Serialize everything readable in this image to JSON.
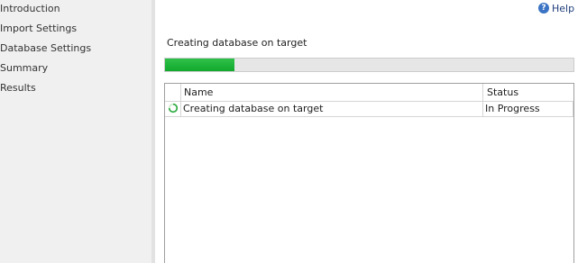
{
  "sidebar": {
    "items": [
      {
        "label": "Introduction"
      },
      {
        "label": "Import Settings"
      },
      {
        "label": "Database Settings"
      },
      {
        "label": "Summary"
      },
      {
        "label": "Results"
      }
    ]
  },
  "help": {
    "label": "Help",
    "icon": "help-icon"
  },
  "stage": {
    "text": "Creating database on target"
  },
  "progress": {
    "percent": 17,
    "color": "#1db53a"
  },
  "grid": {
    "columns": [
      "Name",
      "Status"
    ],
    "rows": [
      {
        "icon": "spinner-icon",
        "name": "Creating database on target",
        "status": "In Progress"
      }
    ]
  }
}
